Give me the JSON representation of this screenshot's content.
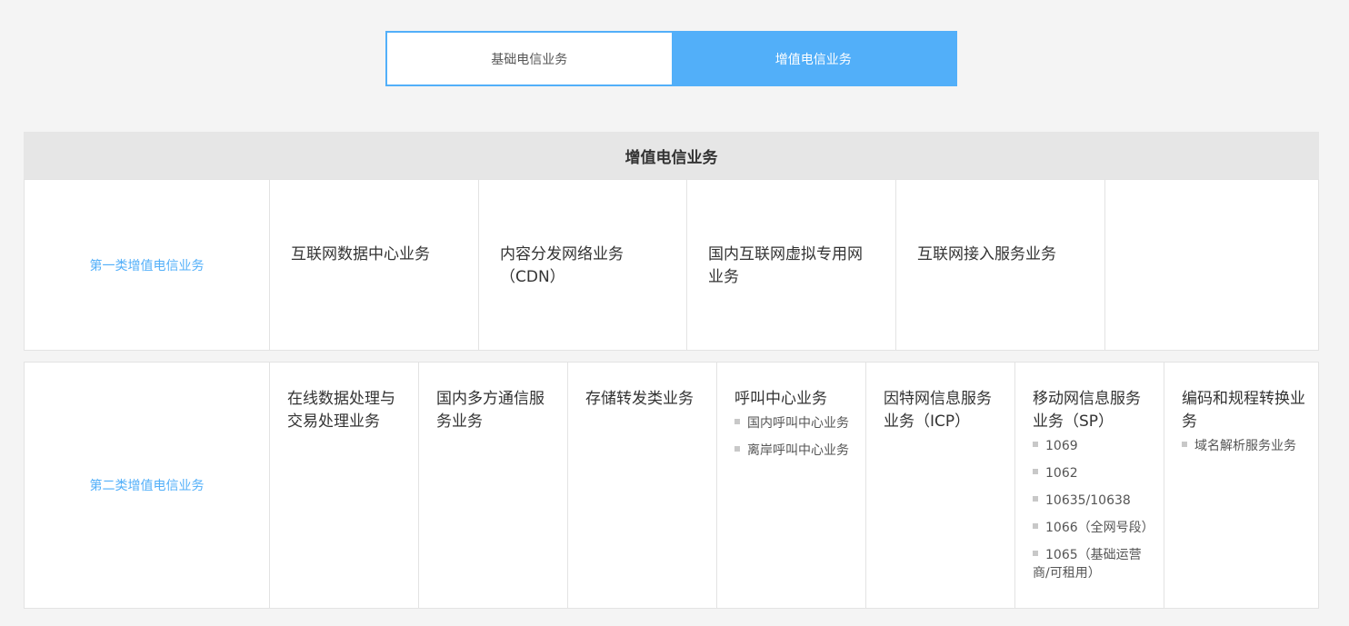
{
  "tabs": [
    {
      "label": "基础电信业务",
      "active": false
    },
    {
      "label": "增值电信业务",
      "active": true
    }
  ],
  "section_title": "增值电信业务",
  "category_1": {
    "label": "第一类增值电信业务",
    "services": [
      "互联网数据中心业务",
      "内容分发网络业务（CDN）",
      "国内互联网虚拟专用网业务",
      "互联网接入服务业务"
    ]
  },
  "category_2": {
    "label": "第二类增值电信业务",
    "services": [
      {
        "title": "在线数据处理与交易处理业务",
        "items": []
      },
      {
        "title": "国内多方通信服务业务",
        "items": []
      },
      {
        "title": "存储转发类业务",
        "items": []
      },
      {
        "title": "呼叫中心业务",
        "items": [
          "国内呼叫中心业务",
          "离岸呼叫中心业务"
        ]
      },
      {
        "title": "因特网信息服务业务（ICP）",
        "items": []
      },
      {
        "title": "移动网信息服务业务（SP）",
        "items": [
          "1069",
          "1062",
          "10635/10638",
          "1066（全网号段）",
          "1065（基础运营商/可租用）"
        ]
      },
      {
        "title": "编码和规程转换业务",
        "items": [
          "域名解析服务业务"
        ]
      }
    ]
  },
  "colors": {
    "accent": "#52aff9",
    "header_bg": "#e6e6e6",
    "page_bg": "#f4f4f4",
    "bullet": "#c8c8c8"
  }
}
